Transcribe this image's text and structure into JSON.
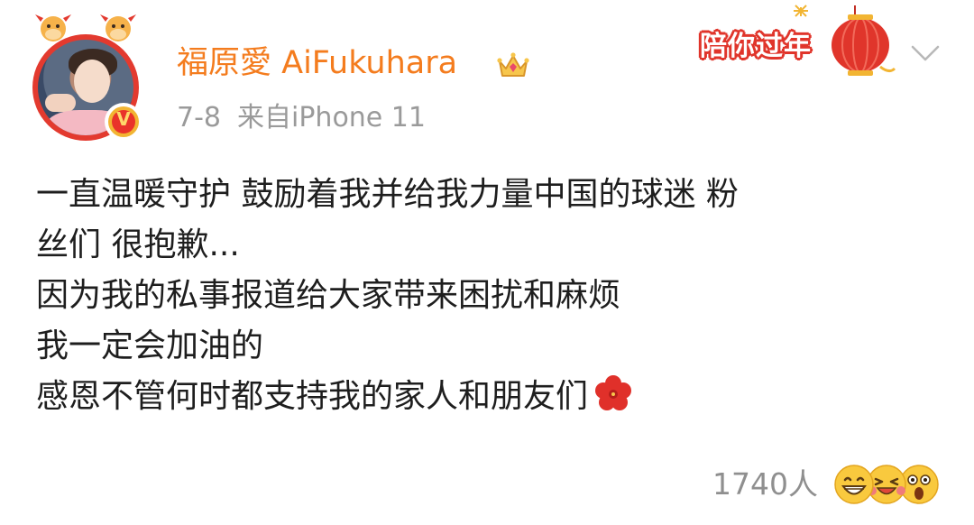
{
  "post": {
    "author": {
      "name": "福原愛 AiFukuhara",
      "verified": true,
      "avatar_icon": "avatar-photo",
      "member_badge_icon": "crown-icon"
    },
    "meta": {
      "date": "7-8",
      "source": "来自iPhone 11"
    },
    "festival_badge": {
      "label": "陪你过年",
      "icon": "lantern-icon"
    },
    "menu_icon": "chevron-down-icon",
    "content_lines": [
      "一直温暖守护 鼓励着我并给我力量中国的球迷 粉",
      "丝们 很抱歉...",
      "因为我的私事报道给大家带来困扰和麻烦",
      "我一定会加油的",
      "感恩不管何时都支持我的家人和朋友们"
    ],
    "content_end_icon": "red-flower-emoji",
    "reactions": {
      "count": "1740人",
      "icons": [
        "grinning-face-emoji",
        "laughing-crying-face-emoji",
        "astonished-face-emoji"
      ]
    },
    "colors": {
      "username": "#f47c1e",
      "meta": "#9a9a9a",
      "text": "#1e1e1e",
      "badge_red": "#e0352b"
    }
  }
}
